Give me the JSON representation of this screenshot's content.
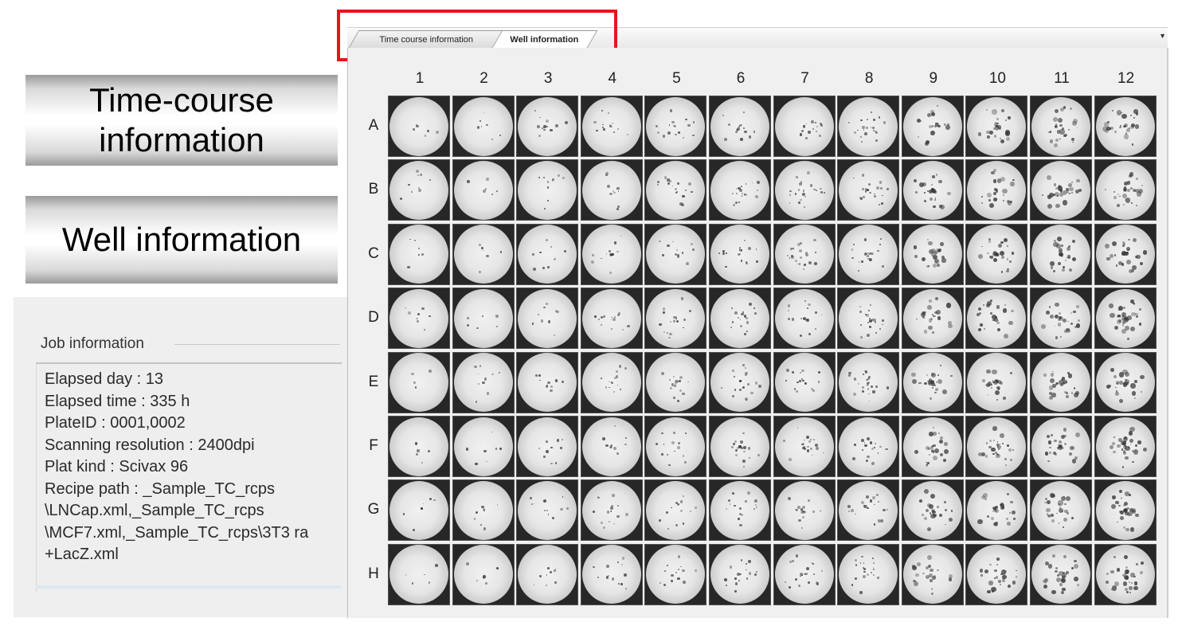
{
  "callouts": {
    "time_course_line1": "Time-course",
    "time_course_line2": "information",
    "well": "Well information"
  },
  "tabs": [
    {
      "label": "Time course information",
      "selected": false
    },
    {
      "label": "Well information",
      "selected": true
    }
  ],
  "tab_dropdown_icon": "chevron-down-icon",
  "highlight_color": "#e8141c",
  "job_info": {
    "legend": "Job information",
    "lines": [
      "Elapsed day : 13",
      "Elapsed time : 335 h",
      "PlateID : 0001,0002",
      "Scanning resolution : 2400dpi",
      "Plat kind : Scivax 96",
      "Recipe path : _Sample_TC_rcps",
      "\\LNCap.xml,_Sample_TC_rcps",
      "\\MCF7.xml,_Sample_TC_rcps\\3T3 ra",
      "+LacZ.xml"
    ]
  },
  "plate": {
    "columns": [
      "1",
      "2",
      "3",
      "4",
      "5",
      "6",
      "7",
      "8",
      "9",
      "10",
      "11",
      "12"
    ],
    "rows": [
      "A",
      "B",
      "C",
      "D",
      "E",
      "F",
      "G",
      "H"
    ]
  }
}
